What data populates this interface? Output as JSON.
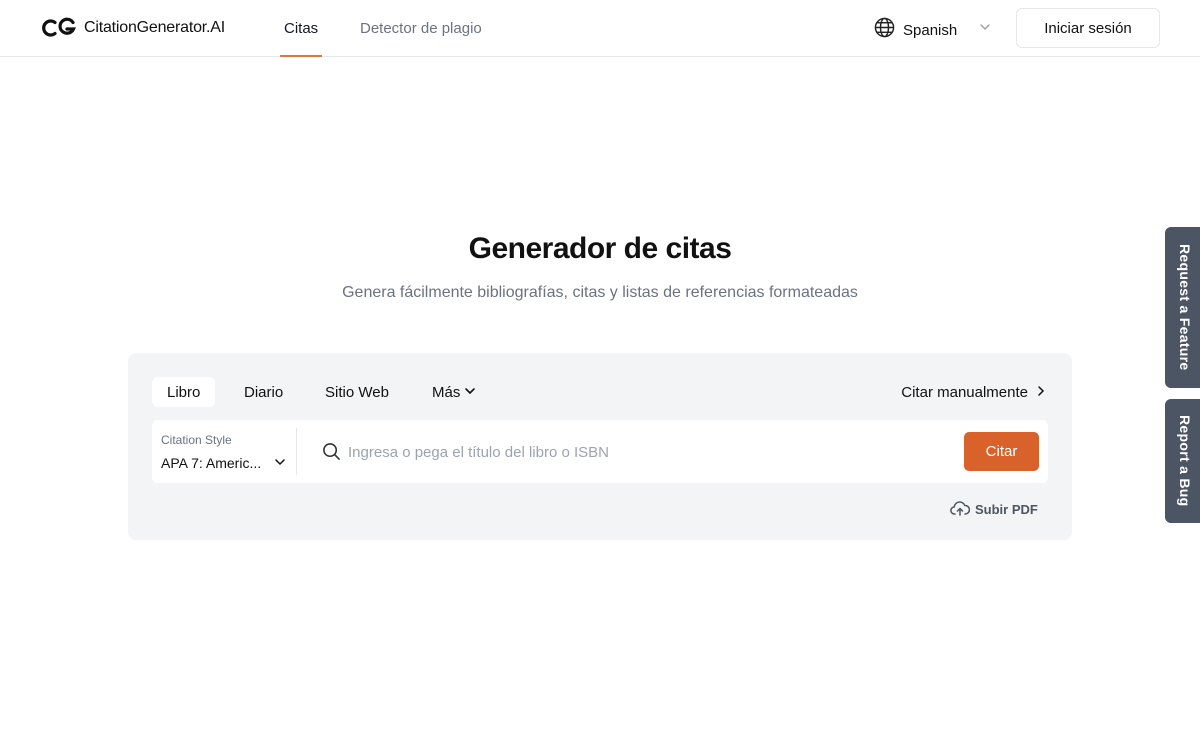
{
  "header": {
    "logo_text": "CitationGenerator.AI",
    "nav": [
      {
        "label": "Citas",
        "active": true
      },
      {
        "label": "Detector de plagio",
        "active": false
      }
    ],
    "language": {
      "icon": "globe-icon",
      "value": "Spanish"
    },
    "login_label": "Iniciar sesión"
  },
  "hero": {
    "title": "Generador de citas",
    "subtitle": "Genera fácilmente bibliografías, citas y listas de referencias formateadas"
  },
  "citation_card": {
    "source_tabs": [
      {
        "label": "Libro",
        "active": true
      },
      {
        "label": "Diario",
        "active": false
      },
      {
        "label": "Sitio Web",
        "active": false
      },
      {
        "label": "Más",
        "active": false,
        "has_dropdown": true
      }
    ],
    "manual_label": "Citar manualmente",
    "style_label": "Citation Style",
    "style_value": "APA 7: Americ...",
    "search": {
      "placeholder": "Ingresa o pega el título del libro o ISBN",
      "value": ""
    },
    "cite_label": "Citar",
    "upload_label": "Subir PDF",
    "accent_color": "#d9622b"
  },
  "side_tabs": {
    "feature": "Request a Feature",
    "bug": "Report a Bug"
  }
}
